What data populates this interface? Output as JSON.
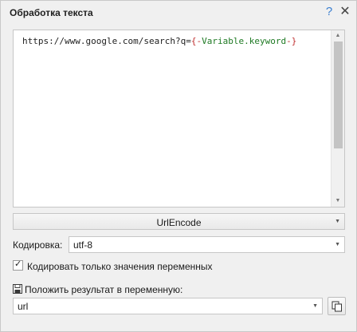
{
  "window": {
    "title": "Обработка текста",
    "help_glyph": "?",
    "close_glyph": "✕"
  },
  "editor": {
    "text_prefix": "https://www.google.com/search?q=",
    "macro_open": "{-",
    "macro_var": "Variable.keyword",
    "macro_close": "-}"
  },
  "method": {
    "selected": "UrlEncode"
  },
  "encoding": {
    "label": "Кодировка:",
    "selected": "utf-8"
  },
  "option": {
    "checked": true,
    "check_glyph": "✓",
    "label": "Кодировать только значения переменных"
  },
  "result": {
    "label": "Положить результат в переменную:",
    "variable": "url"
  },
  "icons": {
    "dropdown_arrow": "▼",
    "scroll_up": "▲",
    "scroll_down": "▼",
    "save": "save-icon",
    "copy": "copy-icon"
  },
  "colors": {
    "window_bg": "#f0f0f0",
    "macro_brace": "#c03030",
    "macro_variable": "#1f7a24",
    "help_icon": "#3a7fd0"
  }
}
